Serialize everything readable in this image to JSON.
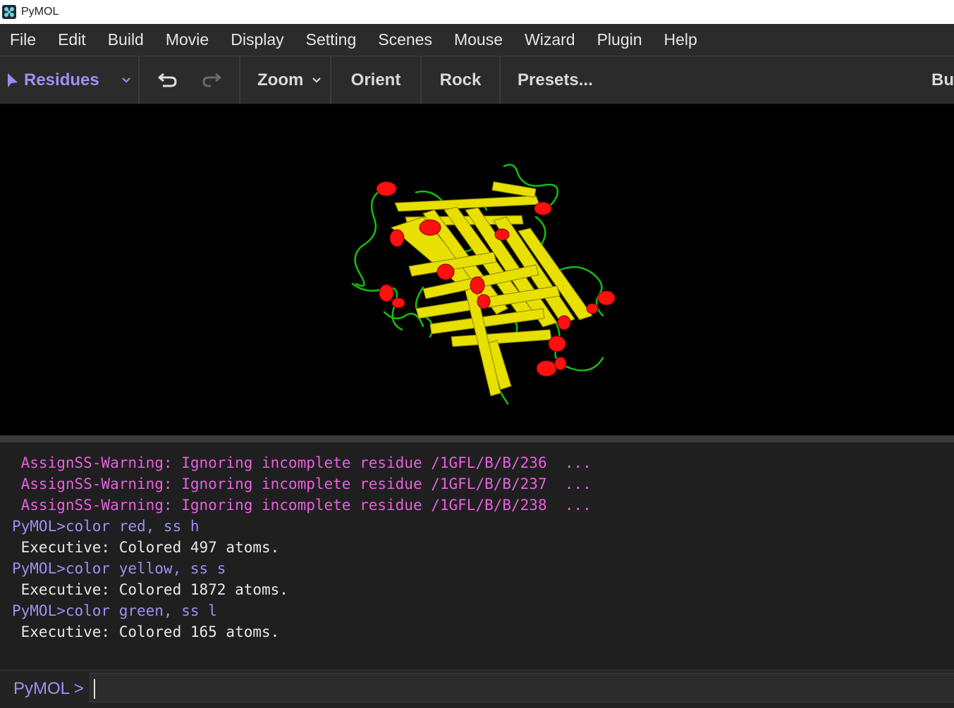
{
  "window": {
    "title": "PyMOL"
  },
  "menu": [
    "File",
    "Edit",
    "Build",
    "Movie",
    "Display",
    "Setting",
    "Scenes",
    "Mouse",
    "Wizard",
    "Plugin",
    "Help"
  ],
  "toolbar": {
    "mode_label": "Residues",
    "zoom_label": "Zoom",
    "orient_label": "Orient",
    "rock_label": "Rock",
    "presets_label": "Presets...",
    "build_label": "Bu"
  },
  "viewport": {
    "background": "#000000",
    "colors": {
      "helix": "#ff0000",
      "sheet": "#ffff00",
      "loop": "#00c000"
    }
  },
  "console": {
    "lines": [
      {
        "type": "warn",
        "text": " AssignSS-Warning: Ignoring incomplete residue /1GFL/B/B/236  ..."
      },
      {
        "type": "warn",
        "text": " AssignSS-Warning: Ignoring incomplete residue /1GFL/B/B/237  ..."
      },
      {
        "type": "warn",
        "text": " AssignSS-Warning: Ignoring incomplete residue /1GFL/B/B/238  ..."
      },
      {
        "type": "cmd",
        "text": "PyMOL>color red, ss h"
      },
      {
        "type": "info",
        "text": " Executive: Colored 497 atoms."
      },
      {
        "type": "cmd",
        "text": "PyMOL>color yellow, ss s"
      },
      {
        "type": "info",
        "text": " Executive: Colored 1872 atoms."
      },
      {
        "type": "cmd",
        "text": "PyMOL>color green, ss l"
      },
      {
        "type": "info",
        "text": " Executive: Colored 165 atoms."
      }
    ]
  },
  "command": {
    "prompt": "PyMOL >",
    "value": ""
  }
}
